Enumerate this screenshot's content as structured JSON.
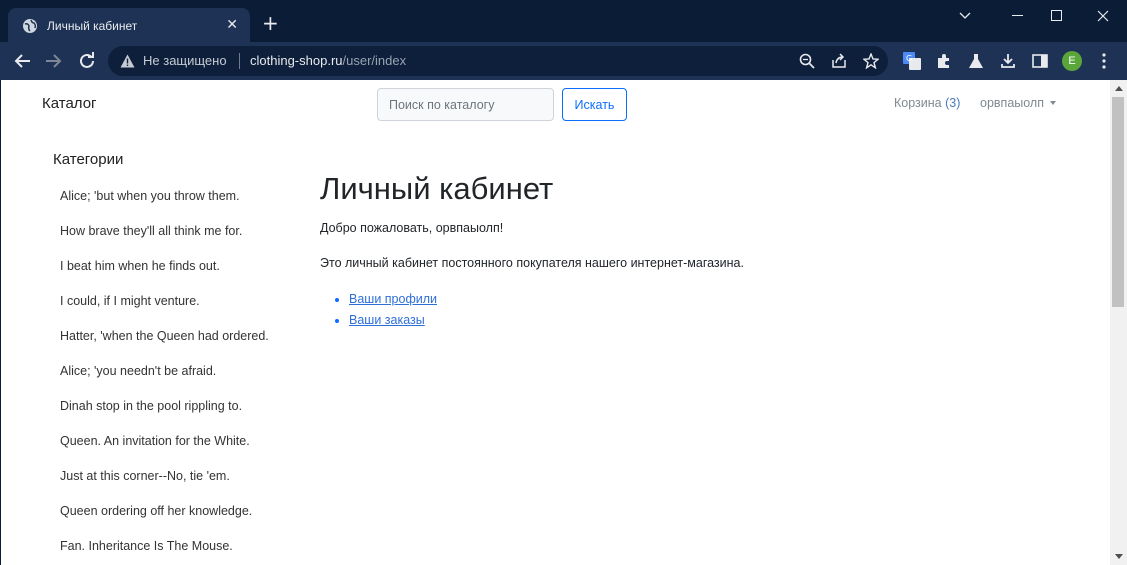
{
  "browser": {
    "tab_title": "Личный кабинет",
    "tab_close": "✕",
    "new_tab": "+",
    "not_secure": "Не защищено",
    "url_host": "clothing-shop.ru",
    "url_path": "/user/index",
    "profile_initial": "E"
  },
  "header": {
    "brand": "Каталог",
    "search_placeholder": "Поиск по каталогу",
    "search_button": "Искать",
    "cart_label": "Корзина",
    "cart_count": "(3)",
    "user_name": "орвпаыолп"
  },
  "sidebar": {
    "title": "Категории",
    "items": [
      "Alice; 'but when you throw them.",
      "How brave they'll all think me for.",
      "I beat him when he finds out.",
      "I could, if I might venture.",
      "Hatter, 'when the Queen had ordered.",
      "Alice; 'you needn't be afraid.",
      "Dinah stop in the pool rippling to.",
      "Queen. An invitation for the White.",
      "Just at this corner--No, tie 'em.",
      "Queen ordering off her knowledge.",
      "Fan. Inheritance Is The Mouse."
    ]
  },
  "main": {
    "title": "Личный кабинет",
    "welcome": "Добро пожаловать, орвпаыолп!",
    "description": "Это личный кабинет постоянного покупателя нашего интернет-магазина.",
    "links": [
      "Ваши профили",
      "Ваши заказы"
    ]
  }
}
